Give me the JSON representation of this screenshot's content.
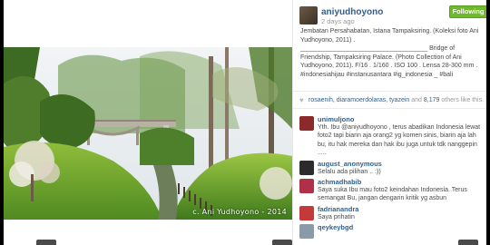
{
  "post": {
    "username": "aniyudhoyono",
    "timestamp": "2 days ago",
    "follow_label": "Following",
    "caption_lines": [
      "Jembatan Persahabatan, Istana Tampaksiring. (Koleksi foto Ani Yudhoyono, 2011) .",
      "____________________________________ Bridge of Friendship, Tampaksiring Palace. (Photo Collection of Ani Yudhoyono, 2011). F/16 . 1/160 . ISO 100 . Lensa 28-300 mm . #indonesiahijau #instanusantara #ig_indonesia _ #bali"
    ],
    "photo_credit": "c. Ani Yudhoyono - 2014",
    "likes": {
      "names": "rosaenih, diaramoerdolaras, tyazein",
      "connector": "and",
      "count_text": "8,179",
      "suffix": "others like this."
    }
  },
  "comments": [
    {
      "user": "unimuljono",
      "text": "Yth. Ibu @aniyudhoyono , terus abadikan Indonesia lewat foto2 tapi biarin aja orang2 yg komen sinis, biarin aja lah bu, itu hak mereka dan hak ibu juga untuk tdk nanggepin .....",
      "avatar_color": "#8a2a2a"
    },
    {
      "user": "august_anonymous",
      "text": "Selalu ada pilihan .. :))",
      "avatar_color": "#2b2b2b"
    },
    {
      "user": "achmadhabib",
      "text": "Saya suka Ibu mau foto2 keindahan Indonesia. Terus semangat Bu, jangan dengarin kritik yg asbun",
      "avatar_color": "#b0304a"
    },
    {
      "user": "fadrianandra",
      "text": "Saya prihatin",
      "avatar_color": "#c43a3a"
    },
    {
      "user": "qeykeybgd",
      "text": "",
      "avatar_color": "#8a9aa8"
    }
  ]
}
